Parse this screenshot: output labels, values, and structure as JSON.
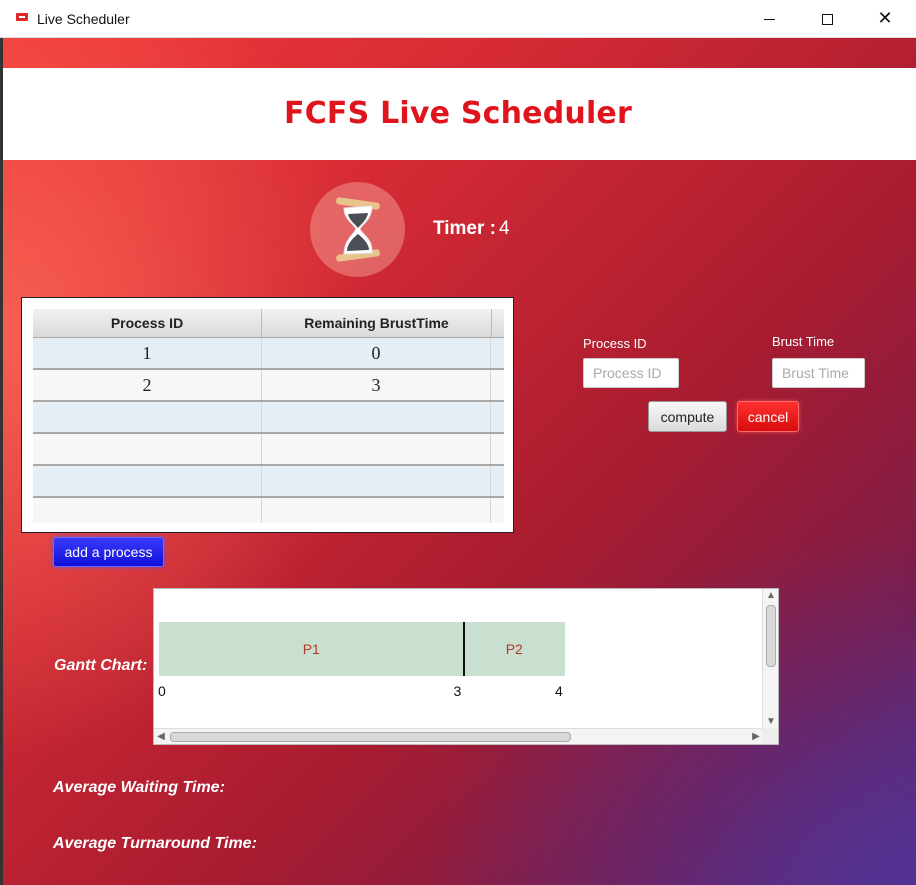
{
  "window": {
    "title": "Live Scheduler",
    "controls": {
      "minimize": "minimize",
      "maximize": "maximize",
      "close": "✕"
    }
  },
  "header": {
    "title": "FCFS Live Scheduler"
  },
  "timer": {
    "label": "Timer :",
    "value": "4",
    "icon": "hourglass-icon"
  },
  "process_table": {
    "columns": [
      "Process ID",
      "Remaining BrustTime"
    ],
    "rows": [
      {
        "process_id": "1",
        "remaining": "0"
      },
      {
        "process_id": "2",
        "remaining": "3"
      }
    ]
  },
  "form": {
    "process_id_label": "Process ID",
    "process_id_placeholder": "Process ID",
    "burst_time_label": "Brust Time",
    "burst_time_placeholder": "Brust Time",
    "compute_label": "compute",
    "cancel_label": "cancel"
  },
  "add_process_label": "add a process",
  "gantt": {
    "label": "Gantt Chart:",
    "segments": [
      {
        "name": "P1",
        "start": 0,
        "end": 3
      },
      {
        "name": "P2",
        "start": 3,
        "end": 4
      }
    ],
    "ticks": [
      "0",
      "3",
      "4"
    ]
  },
  "stats": {
    "avg_waiting_label": "Average Waiting Time:",
    "avg_turnaround_label": "Average Turnaround Time:"
  },
  "colors": {
    "title_red": "#e0141c",
    "cancel_red": "#e81c1c",
    "add_blue": "#1f1fe8",
    "gantt_bar": "#c9dfd0"
  }
}
